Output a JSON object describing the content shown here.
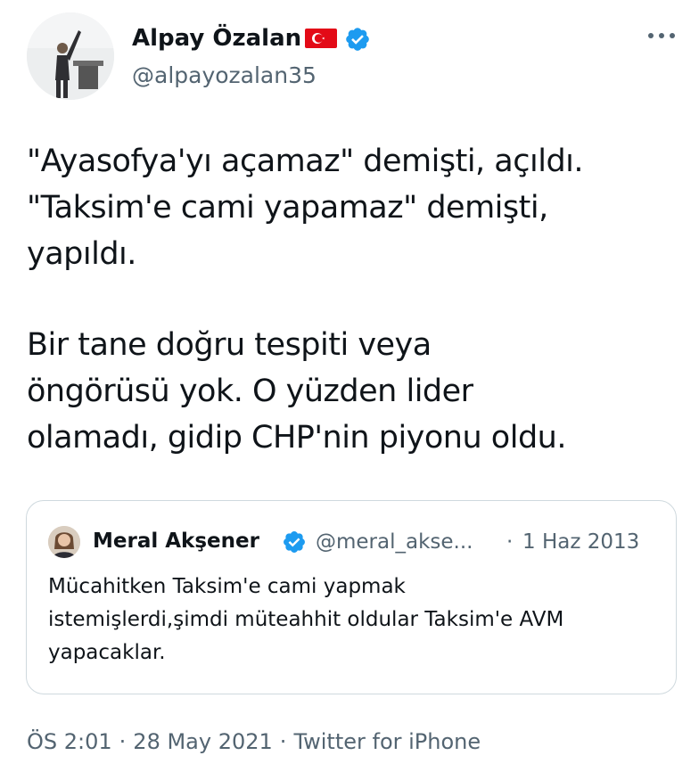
{
  "author": {
    "name": "Alpay Özalan",
    "handle": "@alpayozalan35",
    "flag_icon": "turkey-flag-icon",
    "verified_icon": "verified-badge-icon"
  },
  "menu": {
    "icon": "more-options-icon"
  },
  "tweet": {
    "lines": [
      "\"Ayasofya'yı açamaz\" demişti, açıldı.",
      "\"Taksim'e cami yapamaz\" demişti,",
      "yapıldı.",
      "Bir tane doğru tespiti veya",
      "öngörüsü yok. O yüzden lider",
      "olamadı, gidip CHP'nin piyonu oldu."
    ]
  },
  "quote": {
    "name": "Meral Akşener",
    "handle": "@meral_akse...",
    "dot": "·",
    "date": "1 Haz 2013",
    "lines": [
      "Mücahitken Taksim'e cami yapmak",
      "istemişlerdi,şimdi müteahhit oldular Taksim'e AVM",
      "yapacaklar."
    ]
  },
  "meta": {
    "time": "ÖS 2:01",
    "sep1": "·",
    "date": "28 May 2021",
    "sep2": "·",
    "source": "Twitter for iPhone"
  },
  "colors": {
    "verified": "#1d9bf0",
    "flag_red": "#e30a17",
    "text_primary": "#0f1419",
    "text_secondary": "#536471",
    "border": "#cfd9de"
  }
}
